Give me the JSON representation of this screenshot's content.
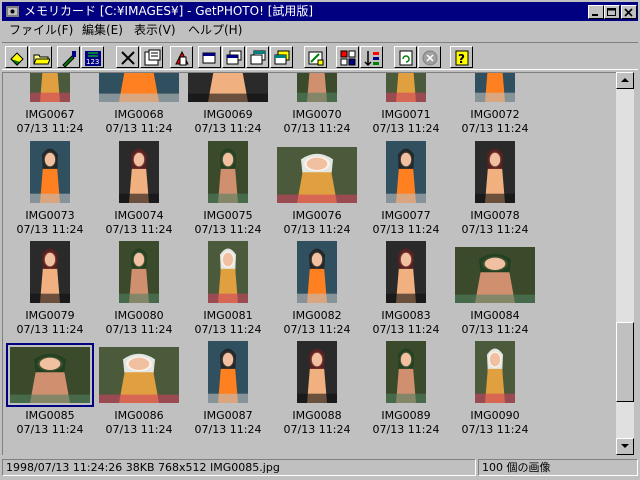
{
  "window": {
    "title": "メモリカード [C:¥IMAGES¥] - GetPHOTO! [試用版]",
    "controls": {
      "minimize": "minimize",
      "maximize": "maximize",
      "close": "close"
    }
  },
  "menu": [
    {
      "label": "ファイル(F)"
    },
    {
      "label": "編集(E)"
    },
    {
      "label": "表示(V)"
    },
    {
      "label": "ヘルプ(H)"
    }
  ],
  "toolbar": [
    {
      "name": "open-icon"
    },
    {
      "name": "folder-icon"
    },
    {
      "name": "eyedropper-icon"
    },
    {
      "name": "numbering-icon"
    },
    {
      "name": "delete-icon"
    },
    {
      "name": "properties-icon"
    },
    {
      "name": "rotate-icon"
    },
    {
      "name": "window-1-icon"
    },
    {
      "name": "window-2-icon"
    },
    {
      "name": "window-3-icon"
    },
    {
      "name": "window-4-icon"
    },
    {
      "name": "view-icon"
    },
    {
      "name": "sort-grid-icon"
    },
    {
      "name": "sort-icon"
    },
    {
      "name": "refresh-icon"
    },
    {
      "name": "stop-icon"
    },
    {
      "name": "help-icon"
    }
  ],
  "grid": {
    "rows": [
      [
        {
          "name": "IMG0067",
          "date": "07/13 11:24"
        },
        {
          "name": "IMG0068",
          "date": "07/13 11:24"
        },
        {
          "name": "IMG0069",
          "date": "07/13 11:24"
        },
        {
          "name": "IMG0070",
          "date": "07/13 11:24"
        },
        {
          "name": "IMG0071",
          "date": "07/13 11:24"
        },
        {
          "name": "IMG0072",
          "date": "07/13 11:24"
        }
      ],
      [
        {
          "name": "IMG0073",
          "date": "07/13 11:24"
        },
        {
          "name": "IMG0074",
          "date": "07/13 11:24"
        },
        {
          "name": "IMG0075",
          "date": "07/13 11:24"
        },
        {
          "name": "IMG0076",
          "date": "07/13 11:24"
        },
        {
          "name": "IMG0077",
          "date": "07/13 11:24"
        },
        {
          "name": "IMG0078",
          "date": "07/13 11:24"
        }
      ],
      [
        {
          "name": "IMG0079",
          "date": "07/13 11:24"
        },
        {
          "name": "IMG0080",
          "date": "07/13 11:24"
        },
        {
          "name": "IMG0081",
          "date": "07/13 11:24"
        },
        {
          "name": "IMG0082",
          "date": "07/13 11:24"
        },
        {
          "name": "IMG0083",
          "date": "07/13 11:24"
        },
        {
          "name": "IMG0084",
          "date": "07/13 11:24"
        }
      ],
      [
        {
          "name": "IMG0085",
          "date": "07/13 11:24"
        },
        {
          "name": "IMG0086",
          "date": "07/13 11:24"
        },
        {
          "name": "IMG0087",
          "date": "07/13 11:24"
        },
        {
          "name": "IMG0088",
          "date": "07/13 11:24"
        },
        {
          "name": "IMG0089",
          "date": "07/13 11:24"
        },
        {
          "name": "IMG0090",
          "date": "07/13 11:24"
        }
      ]
    ],
    "selected": "IMG0085"
  },
  "status": {
    "info": "1998/07/13 11:24:26   38KB   768x512   IMG0085.jpg",
    "count": "100 個の画像"
  },
  "colors": {
    "titlebar": "#000080",
    "face": "#c0c0c0"
  }
}
